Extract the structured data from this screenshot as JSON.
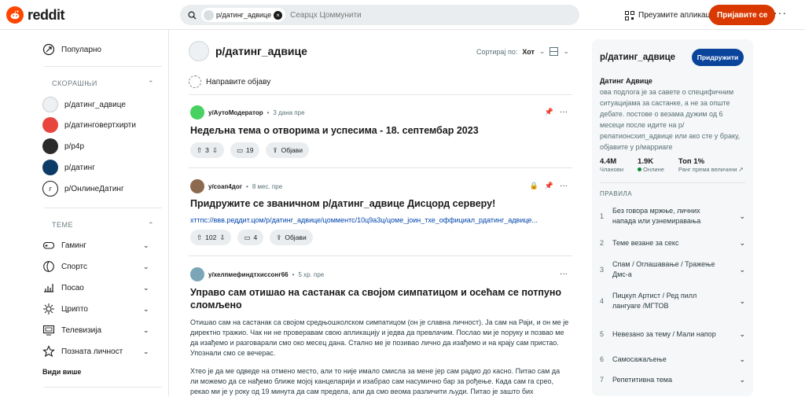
{
  "header": {
    "logo_text": "reddit",
    "search_chip": "р/датинг_адвице",
    "search_placeholder": "Сеарцх Цоммунити",
    "get_app": "Преузмите апликацију",
    "login": "Пријавите се"
  },
  "left_nav": {
    "popular": "Популарно",
    "recent_title": "СКОРАШЊИ",
    "recent": [
      {
        "label": "р/датинг_адвице",
        "color": "#eef1f3"
      },
      {
        "label": "р/датинговертхирти",
        "color": "#e8453c"
      },
      {
        "label": "р/p4p",
        "color": "#2b2b2b"
      },
      {
        "label": "р/датинг",
        "color": "#0b3b66"
      },
      {
        "label": "р/ОнлинеДатинг",
        "color": "#ffffff"
      }
    ],
    "topics_title": "ТЕМЕ",
    "topics": [
      "Гаминг",
      "Спортс",
      "Посао",
      "Црипто",
      "Телевизија",
      "Позната личност"
    ],
    "see_more": "Види више"
  },
  "main": {
    "subreddit": "р/датинг_адвице",
    "sort_label": "Сортирај по:",
    "sort_value": "Хот",
    "create_post": "Направите објаву",
    "posts": [
      {
        "user": "у/АутоМодератор",
        "time": "3 дана пре",
        "title": "Недељна тема о отворима и успесима - 18. септембар 2023",
        "votes": "3",
        "comments": "19",
        "share": "Објави"
      },
      {
        "user": "у/соап4дог",
        "time": "8 мес. пре",
        "title": "Придружите се званичном р/датинг_адвице Дисцорд серверу!",
        "link": "хттпс://ввв.реддит.цом/р/датинг_адвице/цомментс/10ц9а3ц/цоме_јоин_тхе_оффициал_рдатинг_адвице...",
        "votes": "102",
        "comments": "4",
        "share": "Објави"
      },
      {
        "user": "у/хелпмефиндтхиссонг66",
        "time": "5 хр. пре",
        "title": "Управо сам отишао на састанак са својом симпатицом и осећам се потпуно сломљено",
        "body1": "Отишао сам на састанак са својом средњошколском симпатицом (он је славна личност). Ја сам на Раји, и он ме је директно тражио. Чак ни не проверавам свою апликацију и једва да превлачим. Послао ми је поруку и позвао ме да изађемо и разговарали смо око месец дана. Стално ме је позивао лично да изађемо и на крају сам пристао. Упознали смо се вечерас.",
        "body2": "Хтео је да ме одведе на отмено место, али то није имало смисла за мене јер сам радио до касно. Питао сам да ли можемо да се нађемо ближе мојој канцеларији и изабрао сам насумично бар за рођење. Када сам га срео, рекао ми је у року од 19 минута да сам предела, али да смо веома различити људи. Питао је зашто бих"
      }
    ]
  },
  "sidebar": {
    "title": "р/датинг_адвице",
    "join": "Придружити",
    "subtitle": "Датинг Адвице",
    "description": "ова подлога је за савете о специфичним ситуацијама за састанке, а не за опште дебате. постове о везама дужим од 6 месеци после идите на р/релатионсхип_адвице или ако сте у браку, објавите у р/марриаге",
    "members": "4.4M",
    "members_label": "Чланови",
    "online": "1.9K",
    "online_label": "Онлине",
    "rank": "Топ 1%",
    "rank_label": "Ранг према величини",
    "rules_title": "ПРАВИЛА",
    "rules": [
      "Без говора мржње, личних напада или узнемиравања",
      "Теме везане за секс",
      "Спам / Оглашавање / Тражење Дмс-а",
      "Пицкуп Артист / Ред пилл лангуаге /МГТОВ",
      "Невезано за тему / Мали напор",
      "Самосажаљење",
      "Репетитивна тема"
    ]
  }
}
